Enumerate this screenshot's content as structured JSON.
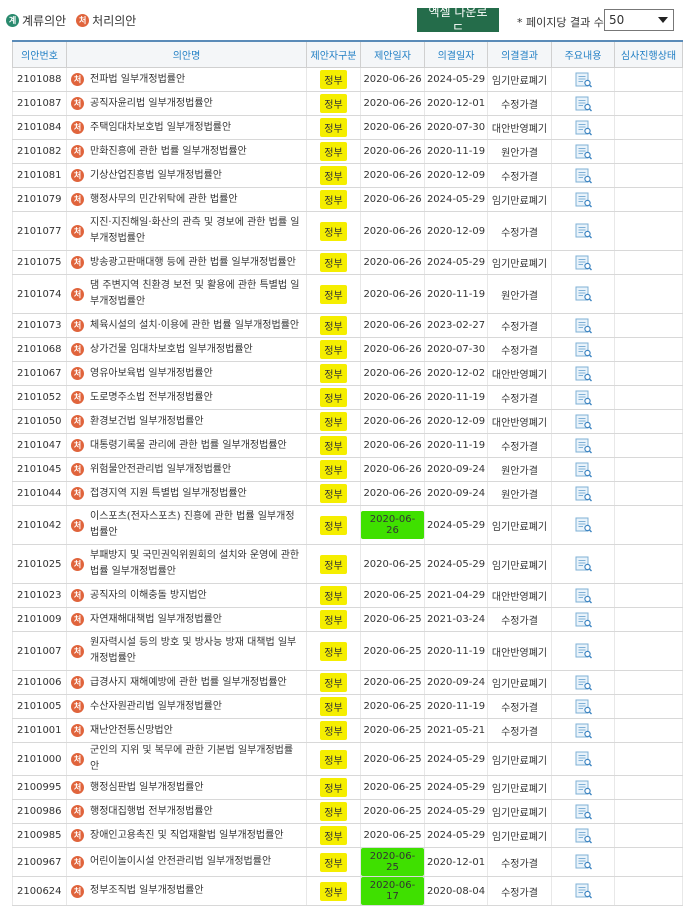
{
  "legend": {
    "pending_badge": "계",
    "pending_label": "계류의안",
    "processed_badge": "처",
    "processed_label": "처리의안"
  },
  "toolbar": {
    "excel_label": "엑셀 다운로드",
    "perpage_label": "* 페이지당 결과 수",
    "perpage_value": "50"
  },
  "columns": [
    "의안번호",
    "의안명",
    "제안자구분",
    "제안일자",
    "의결일자",
    "의결결과",
    "주요내용",
    "심사진행상태"
  ],
  "rows": [
    {
      "num": "2101088",
      "title": "전파법 일부개정법률안",
      "proposer": "정부",
      "proposed": "2020-06-26",
      "decided": "2024-05-29",
      "result": "임기만료폐기",
      "lines": 1
    },
    {
      "num": "2101087",
      "title": "공직자윤리법 일부개정법률안",
      "proposer": "정부",
      "proposed": "2020-06-26",
      "decided": "2020-12-01",
      "result": "수정가결",
      "lines": 1
    },
    {
      "num": "2101084",
      "title": "주택임대차보호법 일부개정법률안",
      "proposer": "정부",
      "proposed": "2020-06-26",
      "decided": "2020-07-30",
      "result": "대안반영폐기",
      "lines": 1
    },
    {
      "num": "2101082",
      "title": "만화진흥에 관한 법률 일부개정법률안",
      "proposer": "정부",
      "proposed": "2020-06-26",
      "decided": "2020-11-19",
      "result": "원안가결",
      "lines": 1
    },
    {
      "num": "2101081",
      "title": "기상산업진흥법 일부개정법률안",
      "proposer": "정부",
      "proposed": "2020-06-26",
      "decided": "2020-12-09",
      "result": "수정가결",
      "lines": 1
    },
    {
      "num": "2101079",
      "title": "행정사무의 민간위탁에 관한 법률안",
      "proposer": "정부",
      "proposed": "2020-06-26",
      "decided": "2024-05-29",
      "result": "임기만료폐기",
      "lines": 1
    },
    {
      "num": "2101077",
      "title": "지진·지진해일·화산의 관측 및 경보에 관한 법률 일부개정법률안",
      "proposer": "정부",
      "proposed": "2020-06-26",
      "decided": "2020-12-09",
      "result": "수정가결",
      "lines": 2
    },
    {
      "num": "2101075",
      "title": "방송광고판매대행 등에 관한 법률 일부개정법률안",
      "proposer": "정부",
      "proposed": "2020-06-26",
      "decided": "2024-05-29",
      "result": "임기만료폐기",
      "lines": 1
    },
    {
      "num": "2101074",
      "title": "댐 주변지역 친환경 보전 및 활용에 관한 특별법 일부개정법률안",
      "proposer": "정부",
      "proposed": "2020-06-26",
      "decided": "2020-11-19",
      "result": "원안가결",
      "lines": 2
    },
    {
      "num": "2101073",
      "title": "체육시설의 설치·이용에 관한 법률 일부개정법률안",
      "proposer": "정부",
      "proposed": "2020-06-26",
      "decided": "2023-02-27",
      "result": "수정가결",
      "lines": 1
    },
    {
      "num": "2101068",
      "title": "상가건물 임대차보호법 일부개정법률안",
      "proposer": "정부",
      "proposed": "2020-06-26",
      "decided": "2020-07-30",
      "result": "수정가결",
      "lines": 1
    },
    {
      "num": "2101067",
      "title": "영유아보육법 일부개정법률안",
      "proposer": "정부",
      "proposed": "2020-06-26",
      "decided": "2020-12-02",
      "result": "대안반영폐기",
      "lines": 1
    },
    {
      "num": "2101052",
      "title": "도로명주소법 전부개정법률안",
      "proposer": "정부",
      "proposed": "2020-06-26",
      "decided": "2020-11-19",
      "result": "수정가결",
      "lines": 1
    },
    {
      "num": "2101050",
      "title": "환경보건법 일부개정법률안",
      "proposer": "정부",
      "proposed": "2020-06-26",
      "decided": "2020-12-09",
      "result": "대안반영폐기",
      "lines": 1
    },
    {
      "num": "2101047",
      "title": "대통령기록물 관리에 관한 법률 일부개정법률안",
      "proposer": "정부",
      "proposed": "2020-06-26",
      "decided": "2020-11-19",
      "result": "수정가결",
      "lines": 1
    },
    {
      "num": "2101045",
      "title": "위험물안전관리법 일부개정법률안",
      "proposer": "정부",
      "proposed": "2020-06-26",
      "decided": "2020-09-24",
      "result": "원안가결",
      "lines": 1
    },
    {
      "num": "2101044",
      "title": "접경지역 지원 특별법 일부개정법률안",
      "proposer": "정부",
      "proposed": "2020-06-26",
      "decided": "2020-09-24",
      "result": "원안가결",
      "lines": 1
    },
    {
      "num": "2101042",
      "title": "이스포츠(전자스포츠) 진흥에 관한 법률 일부개정법률안",
      "proposer": "정부",
      "proposed": "2020-06-26",
      "decided": "2024-05-29",
      "result": "임기만료폐기",
      "lines": 2,
      "green": true
    },
    {
      "num": "2101025",
      "title": "부패방지 및 국민권익위원회의 설치와 운영에 관한 법률 일부개정법률안",
      "proposer": "정부",
      "proposed": "2020-06-25",
      "decided": "2024-05-29",
      "result": "임기만료폐기",
      "lines": 2
    },
    {
      "num": "2101023",
      "title": "공직자의 이해충돌 방지법안",
      "proposer": "정부",
      "proposed": "2020-06-25",
      "decided": "2021-04-29",
      "result": "대안반영폐기",
      "lines": 1
    },
    {
      "num": "2101009",
      "title": "자연재해대책법 일부개정법률안",
      "proposer": "정부",
      "proposed": "2020-06-25",
      "decided": "2021-03-24",
      "result": "수정가결",
      "lines": 1
    },
    {
      "num": "2101007",
      "title": "원자력시설 등의 방호 및 방사능 방재 대책법 일부개정법률안",
      "proposer": "정부",
      "proposed": "2020-06-25",
      "decided": "2020-11-19",
      "result": "대안반영폐기",
      "lines": 2
    },
    {
      "num": "2101006",
      "title": "급경사지 재해예방에 관한 법률 일부개정법률안",
      "proposer": "정부",
      "proposed": "2020-06-25",
      "decided": "2020-09-24",
      "result": "임기만료폐기",
      "lines": 1
    },
    {
      "num": "2101005",
      "title": "수산자원관리법 일부개정법률안",
      "proposer": "정부",
      "proposed": "2020-06-25",
      "decided": "2020-11-19",
      "result": "수정가결",
      "lines": 1
    },
    {
      "num": "2101001",
      "title": "재난안전통신망법안",
      "proposer": "정부",
      "proposed": "2020-06-25",
      "decided": "2021-05-21",
      "result": "수정가결",
      "lines": 1
    },
    {
      "num": "2101000",
      "title": "군인의 지위 및 복무에 관한 기본법 일부개정법률안",
      "proposer": "정부",
      "proposed": "2020-06-25",
      "decided": "2024-05-29",
      "result": "임기만료폐기",
      "lines": 1
    },
    {
      "num": "2100995",
      "title": "행정심판법 일부개정법률안",
      "proposer": "정부",
      "proposed": "2020-06-25",
      "decided": "2024-05-29",
      "result": "임기만료폐기",
      "lines": 1
    },
    {
      "num": "2100986",
      "title": "행정대집행법 전부개정법률안",
      "proposer": "정부",
      "proposed": "2020-06-25",
      "decided": "2024-05-29",
      "result": "임기만료폐기",
      "lines": 1
    },
    {
      "num": "2100985",
      "title": "장애인고용촉진 및 직업재활법 일부개정법률안",
      "proposer": "정부",
      "proposed": "2020-06-25",
      "decided": "2024-05-29",
      "result": "임기만료폐기",
      "lines": 1
    },
    {
      "num": "2100967",
      "title": "어린이놀이시설 안전관리법 일부개정법률안",
      "proposer": "정부",
      "proposed": "2020-06-25",
      "decided": "2020-12-01",
      "result": "수정가결",
      "lines": 1,
      "green": true
    },
    {
      "num": "2100624",
      "title": "정부조직법 일부개정법률안",
      "proposer": "정부",
      "proposed": "2020-06-17",
      "decided": "2020-08-04",
      "result": "수정가결",
      "lines": 1,
      "green": true
    }
  ]
}
